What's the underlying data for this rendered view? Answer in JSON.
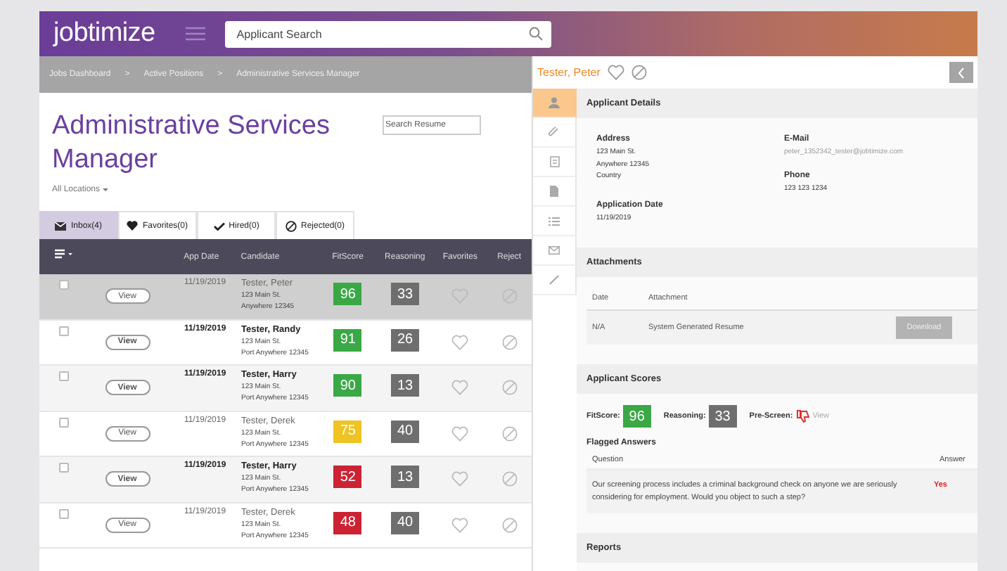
{
  "header": {
    "logo": "jobtimize",
    "search": {
      "placeholder": "Applicant Search"
    }
  },
  "breadcrumb": [
    {
      "label": "Jobs Dashboard",
      "separator": ">"
    },
    {
      "label": "Active Positions",
      "separator": ">"
    },
    {
      "label": "Administrative Services Manager"
    }
  ],
  "job": {
    "title": "Administrative Services Manager",
    "search": {
      "placeholder": "Search Resume"
    },
    "location_filter": "All Locations"
  },
  "tabs": [
    {
      "label": "Inbox(4)",
      "selected": true
    },
    {
      "label": "Favorites(0)",
      "selected": false
    },
    {
      "label": "Hired(0)",
      "selected": false
    },
    {
      "label": "Rejected(0)",
      "selected": false
    }
  ],
  "table": {
    "columns": [
      "App Date",
      "Candidate",
      "FitScore",
      "Reasoning",
      "Favorites",
      "Reject"
    ],
    "rows": [
      {
        "selected": true,
        "unread": false,
        "checked": false,
        "view": "View",
        "app_date": "11/19/2019",
        "name": "Tester, Peter",
        "address_1": "123 Main St.",
        "address_2": "Anywhere 12345",
        "fit_score": "96",
        "color": "#3aa845",
        "reasoning": "33"
      },
      {
        "selected": false,
        "unread": true,
        "checked": false,
        "view": "View",
        "app_date": "11/19/2019",
        "name": "Tester, Randy",
        "address_1": "123 Main St.",
        "address_2": "Port Anywhere 12345",
        "fit_score": "91",
        "color": "#3aa845",
        "reasoning": "26"
      },
      {
        "selected": false,
        "unread": true,
        "checked": false,
        "view": "View",
        "app_date": "11/19/2019",
        "name": "Tester, Harry",
        "address_1": "123 Main St.",
        "address_2": "Port Anywhere 12345",
        "fit_score": "90",
        "color": "#3aa845",
        "reasoning": "13"
      },
      {
        "selected": false,
        "unread": false,
        "checked": false,
        "view": "View",
        "app_date": "11/19/2019",
        "name": "Tester, Derek",
        "address_1": "123 Main St.",
        "address_2": "Port Anywhere 12345",
        "fit_score": "75",
        "color": "#eec322",
        "reasoning": "40"
      },
      {
        "selected": false,
        "unread": true,
        "checked": false,
        "view": "View",
        "app_date": "11/19/2019",
        "name": "Tester, Harry",
        "address_1": "123 Main St.",
        "address_2": "Port Anywhere 12345",
        "fit_score": "52",
        "color": "#cc2233",
        "reasoning": "13"
      },
      {
        "selected": false,
        "unread": false,
        "checked": false,
        "view": "View",
        "app_date": "11/19/2019",
        "name": "Tester, Derek",
        "address_1": "123 Main St.",
        "address_2": "Port Anywhere 12345",
        "fit_score": "48",
        "color": "#cc2233",
        "reasoning": "40"
      }
    ]
  },
  "applicant": {
    "name": "Tester, Peter",
    "side_tabs": [
      {
        "selected": true
      },
      {
        "selected": false
      },
      {
        "selected": false
      },
      {
        "selected": false
      },
      {
        "selected": false
      },
      {
        "selected": false
      },
      {
        "selected": false
      }
    ],
    "details": {
      "title": "Applicant Details",
      "address_label": "Address",
      "address_lines": [
        "123 Main St.",
        "Anywhere 12345",
        "Country"
      ],
      "date_label": "Application Date",
      "date": "11/19/2019",
      "email_label": "E-Mail",
      "email": "peter_1352342_tester@jobtimize.com",
      "phone_label": "Phone",
      "phone": "123 123 1234"
    },
    "attachments": {
      "title": "Attachments",
      "columns": [
        "Date",
        "Attachment"
      ],
      "rows": [
        {
          "date": "N/A",
          "attachment": "System Generated Resume",
          "action": "Download"
        }
      ]
    },
    "scores": {
      "title": "Applicant Scores",
      "fit_label": "FitScore:",
      "fit_score": "96",
      "color": "#3aa845",
      "reasoning_label": "Reasoning:",
      "reasoning": "33",
      "prescreen_label": "Pre-Screen:",
      "prescreen_link": "View"
    },
    "flagged": {
      "title": "Flagged Answers",
      "columns": [
        "Question",
        "Answer"
      ],
      "rows": [
        {
          "question": "Our screening process includes a criminal background check on anyone we are seriously considering for employment. Would you object to such a step?",
          "answer": "Yes"
        }
      ]
    },
    "reports": {
      "title": "Reports"
    }
  }
}
